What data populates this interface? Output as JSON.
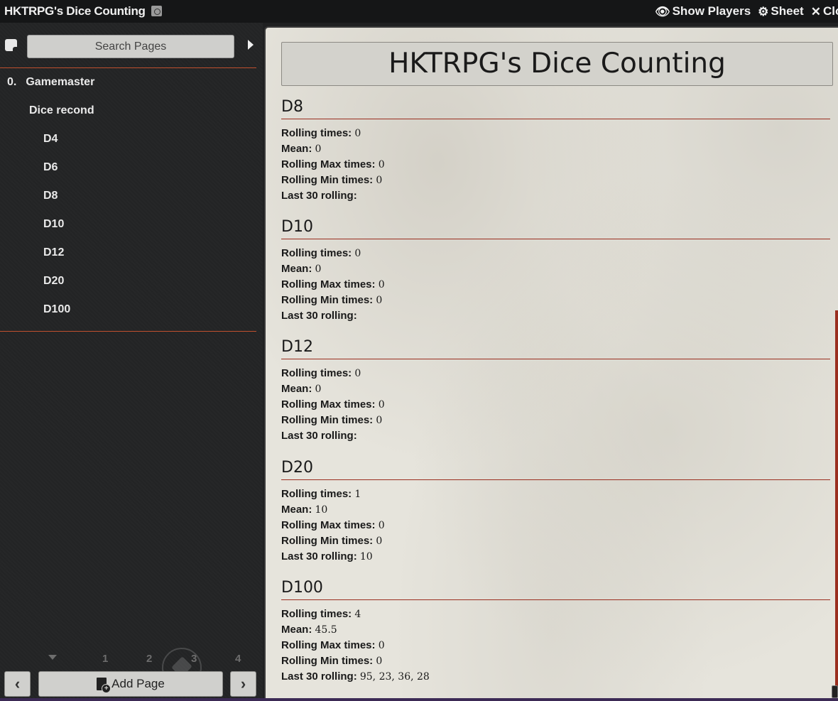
{
  "window": {
    "title": "HKTRPG's Dice Counting",
    "controls": {
      "show_players": "Show Players",
      "sheet": "Sheet",
      "close": "Close"
    }
  },
  "sidebar": {
    "search_placeholder": "Search Pages",
    "tree": {
      "root_number": "0.",
      "root_label": "Gamemaster",
      "folder_label": "Dice recond",
      "pages": [
        "D4",
        "D6",
        "D8",
        "D10",
        "D12",
        "D20",
        "D100"
      ]
    },
    "pager": [
      "1",
      "2",
      "3",
      "4"
    ],
    "add_page_label": "Add Page",
    "icons": {
      "prev": "chevron-left-icon",
      "next": "chevron-right-icon",
      "add": "file-plus-icon"
    }
  },
  "page": {
    "header": "HKTRPG's Dice Counting",
    "labels": {
      "rolling_times": "Rolling times:",
      "mean": "Mean:",
      "max": "Rolling Max times:",
      "min": "Rolling Min times:",
      "last": "Last 30 rolling:"
    },
    "sections": [
      {
        "title": "D8",
        "rolling_times": "0",
        "mean": "0",
        "max": "0",
        "min": "0",
        "last": ""
      },
      {
        "title": "D10",
        "rolling_times": "0",
        "mean": "0",
        "max": "0",
        "min": "0",
        "last": ""
      },
      {
        "title": "D12",
        "rolling_times": "0",
        "mean": "0",
        "max": "0",
        "min": "0",
        "last": ""
      },
      {
        "title": "D20",
        "rolling_times": "1",
        "mean": "10",
        "max": "0",
        "min": "0",
        "last": "10"
      },
      {
        "title": "D100",
        "rolling_times": "4",
        "mean": "45.5",
        "max": "0",
        "min": "0",
        "last": "95, 23, 36, 28"
      }
    ]
  },
  "colors": {
    "accent": "#c0502e",
    "rule": "#9a2e1f",
    "parchment": "#e6e4dc",
    "sidebar_bg": "#232425"
  }
}
